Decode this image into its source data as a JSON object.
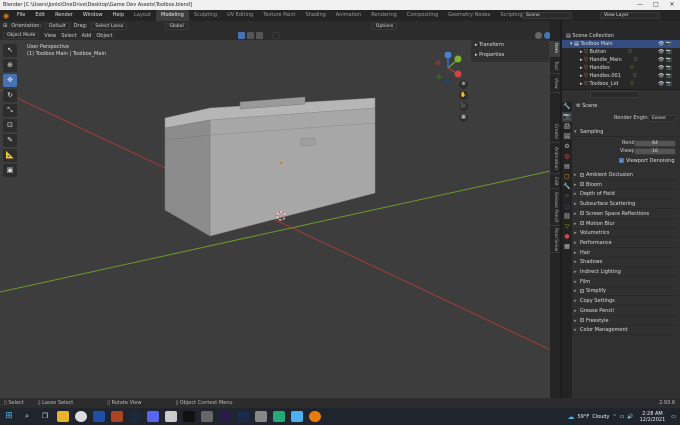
{
  "window": {
    "title": "Blender [C:\\Users\\Jonlo\\OneDrive\\Desktop\\Game Dev Assets\\Toolbox.blend]",
    "minimize": "—",
    "maximize": "□",
    "close": "✕"
  },
  "menu": [
    "File",
    "Edit",
    "Render",
    "Window",
    "Help"
  ],
  "workspaces": [
    "Layout",
    "Modeling",
    "Sculpting",
    "UV Editing",
    "Texture Paint",
    "Shading",
    "Animation",
    "Rendering",
    "Compositing",
    "Geometry Nodes",
    "Scripting"
  ],
  "active_workspace": "Modeling",
  "scene_field": "Scene",
  "view_layer_field": "View Layer",
  "header": {
    "orientation_label": "Orientation:",
    "orientation_value": "Default",
    "drag_label": "Drag:",
    "drag_value": "Select Lasso",
    "transform_space": "Global",
    "options": "Options"
  },
  "header2": {
    "mode": "Object Mode",
    "items": [
      "View",
      "Select",
      "Add",
      "Object"
    ]
  },
  "viewport": {
    "perspective": "User Perspective",
    "collection_info": "(1) Toolbox Main | Toolbox_Main"
  },
  "gizmo": {
    "x": "X",
    "y": "Y",
    "z": "Z"
  },
  "npanel": {
    "sections": [
      "Transform",
      "Properties"
    ]
  },
  "ntabs": [
    "Item",
    "Tool",
    "View",
    "Create",
    "Animation",
    "Edit",
    "Grease Pencil",
    "Real Snow"
  ],
  "outliner": {
    "root": "Scene Collection",
    "collection": "Toolbox Main",
    "items": [
      "Button",
      "Handle_Main",
      "Handles",
      "Handles.001",
      "Toolbox_Lid"
    ]
  },
  "properties": {
    "scene": "Scene",
    "render_engine_label": "Render Engine",
    "render_engine": "Eevee",
    "sampling": "Sampling",
    "render_label": "Render",
    "render_samples": "64",
    "viewport_label": "Viewport",
    "viewport_samples": "16",
    "viewport_denoising": "Viewport Denoising",
    "sections": [
      {
        "label": "Ambient Occlusion",
        "check": true
      },
      {
        "label": "Bloom",
        "check": true
      },
      {
        "label": "Depth of Field",
        "check": false
      },
      {
        "label": "Subsurface Scattering",
        "check": false
      },
      {
        "label": "Screen Space Reflections",
        "check": true
      },
      {
        "label": "Motion Blur",
        "check": true
      },
      {
        "label": "Volumetrics",
        "check": false
      },
      {
        "label": "Performance",
        "check": false
      },
      {
        "label": "Hair",
        "check": false
      },
      {
        "label": "Shadows",
        "check": false
      },
      {
        "label": "Indirect Lighting",
        "check": false
      },
      {
        "label": "Film",
        "check": false
      },
      {
        "label": "Simplify",
        "check": true
      },
      {
        "label": "Copy Settings",
        "check": false
      },
      {
        "label": "Grease Pencil",
        "check": false
      },
      {
        "label": "Freestyle",
        "check": true
      },
      {
        "label": "Color Management",
        "check": false
      }
    ]
  },
  "statusbar": {
    "select": "Select",
    "lasso": "Lasso Select",
    "rotate": "Rotate View",
    "context": "Object Context Menu",
    "version": "2.93.6"
  },
  "taskbar": {
    "weather_temp": "59°F",
    "weather_desc": "Cloudy",
    "time": "2:28 AM",
    "date": "12/2/2021"
  },
  "colors": {
    "accent": "#4772b3",
    "viewport_bg": "#3d3d3d",
    "x_axis": "#a23a3a",
    "y_axis": "#6d9a2c"
  }
}
